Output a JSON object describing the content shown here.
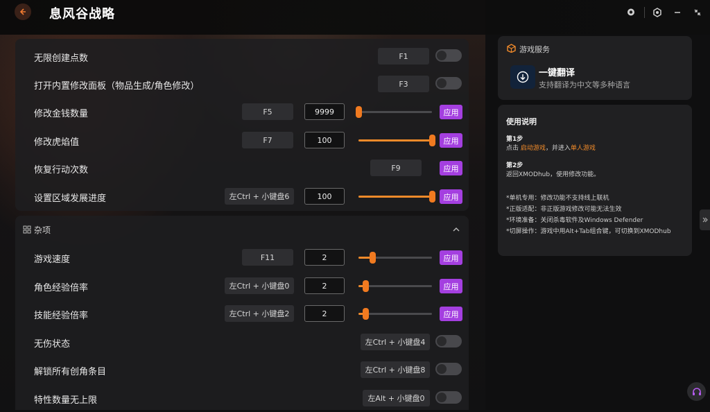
{
  "app": {
    "title": "息风谷战略"
  },
  "section1": {
    "rows": [
      {
        "label": "无限创建点数",
        "hotkey": "F1"
      },
      {
        "label": "打开内置修改面板（物品生成/角色修改）",
        "hotkey": "F3"
      },
      {
        "label": "修改金钱数量",
        "hotkey": "F5",
        "value": "9999",
        "slider": 0.0,
        "apply": "应用"
      },
      {
        "label": "修改虎焰值",
        "hotkey": "F7",
        "value": "100",
        "slider": 1.0,
        "apply": "应用"
      },
      {
        "label": "恢复行动次数",
        "hotkey": "F9",
        "apply": "应用"
      },
      {
        "label": "设置区域发展进度",
        "hotkey": "左Ctrl + 小键盘6",
        "value": "100",
        "slider": 1.0,
        "apply": "应用"
      }
    ]
  },
  "section2": {
    "title": "杂项",
    "rows": [
      {
        "label": "游戏速度",
        "hotkey": "F11",
        "value": "2",
        "slider": 0.19,
        "apply": "应用"
      },
      {
        "label": "角色经验倍率",
        "hotkey": "左Ctrl + 小键盘0",
        "value": "2",
        "slider": 0.09,
        "apply": "应用"
      },
      {
        "label": "技能经验倍率",
        "hotkey": "左Ctrl + 小键盘2",
        "value": "2",
        "slider": 0.09,
        "apply": "应用"
      },
      {
        "label": "无伤状态",
        "hotkey": "左Ctrl + 小键盘4"
      },
      {
        "label": "解锁所有创角条目",
        "hotkey": "左Ctrl + 小键盘8"
      },
      {
        "label": "特性数量无上限",
        "hotkey": "左Alt + 小键盘0"
      }
    ]
  },
  "services": {
    "title": "游戏服务",
    "translate_title": "一键翻译",
    "translate_desc": "支持翻译为中文等多种语言"
  },
  "usage": {
    "title": "使用说明",
    "step1_title": "第1步",
    "step1_pre": "点击 ",
    "step1_link1": "启动游戏",
    "step1_mid": "，并进入",
    "step1_link2": "单人游戏",
    "step2_title": "第2步",
    "step2_text": "返回XMODhub，使用修改功能。",
    "notes": [
      "*单机专用：修改功能不支持线上联机",
      "*正版适配：非正版游戏修改可能无法生效",
      "*环境准备：关闭杀毒软件及Windows Defender",
      "*切屏操作：游戏中用Alt+Tab组合键，可切换到XMODhub"
    ]
  },
  "colors": {
    "accent_orange": "#f08a2a",
    "apply_purple": "#a43fe0"
  }
}
